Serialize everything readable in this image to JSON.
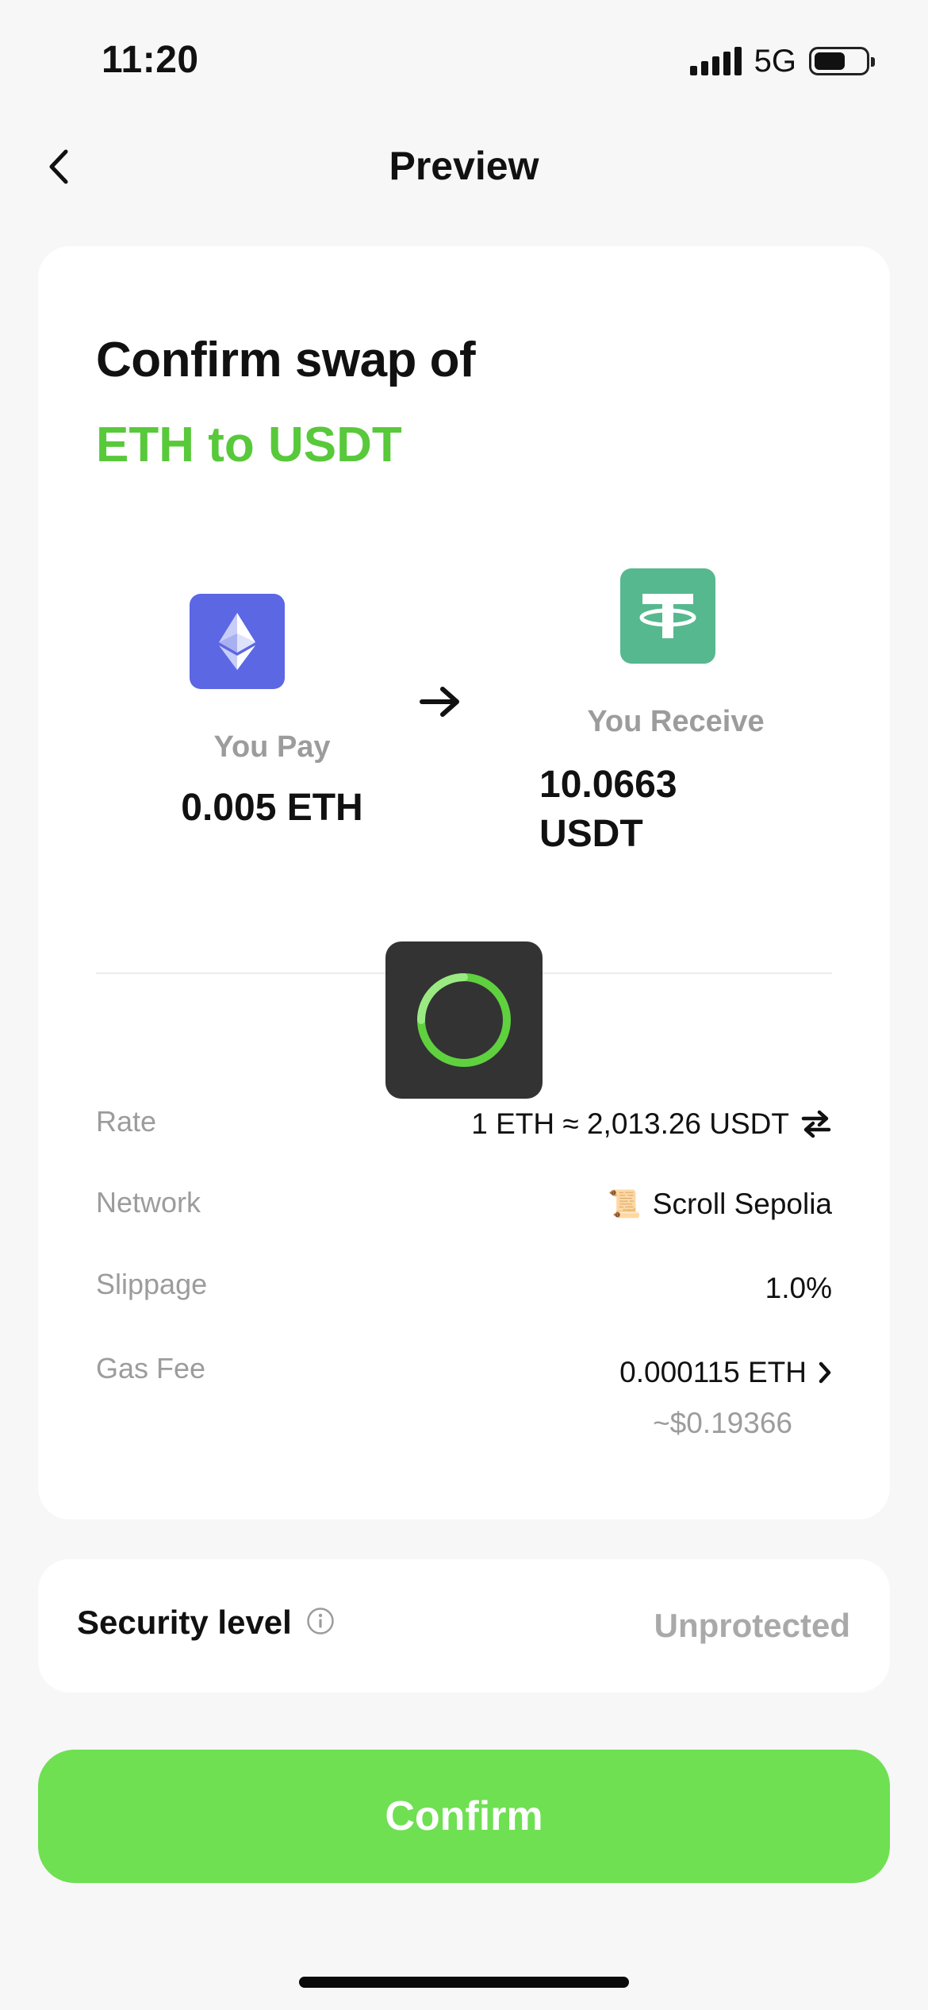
{
  "status_bar": {
    "time": "11:20",
    "network": "5G",
    "battery_level": 0.65
  },
  "header": {
    "title": "Preview"
  },
  "confirm": {
    "heading": "Confirm swap of",
    "pair": "ETH to USDT",
    "pay_label": "You Pay",
    "pay_amount": "0.005 ETH",
    "receive_label": "You Receive",
    "receive_amount": "10.0663 USDT"
  },
  "details": {
    "rate_label": "Rate",
    "rate_value": "1 ETH ≈ 2,013.26 USDT",
    "network_label": "Network",
    "network_emoji": "📜",
    "network_value": "Scroll Sepolia",
    "slippage_label": "Slippage",
    "slippage_value": "1.0%",
    "gas_label": "Gas Fee",
    "gas_value": "0.000115 ETH",
    "gas_usd": "~$0.19366"
  },
  "security": {
    "label": "Security level",
    "value": "Unprotected"
  },
  "actions": {
    "confirm_label": "Confirm"
  },
  "colors": {
    "accent_green": "#6ee052",
    "pair_green": "#58c93a",
    "eth_blue": "#5b67e3",
    "usdt_green": "#56b88f",
    "muted_text": "#9c9c9c"
  },
  "icons": {
    "back": "chevron-left-icon",
    "eth": "ethereum-logo-icon",
    "usdt": "tether-logo-icon",
    "arrow": "arrow-right-icon",
    "swap": "swap-arrows-icon",
    "chevron": "chevron-right-icon",
    "info": "info-circle-icon",
    "spinner": "loading-spinner-icon"
  }
}
